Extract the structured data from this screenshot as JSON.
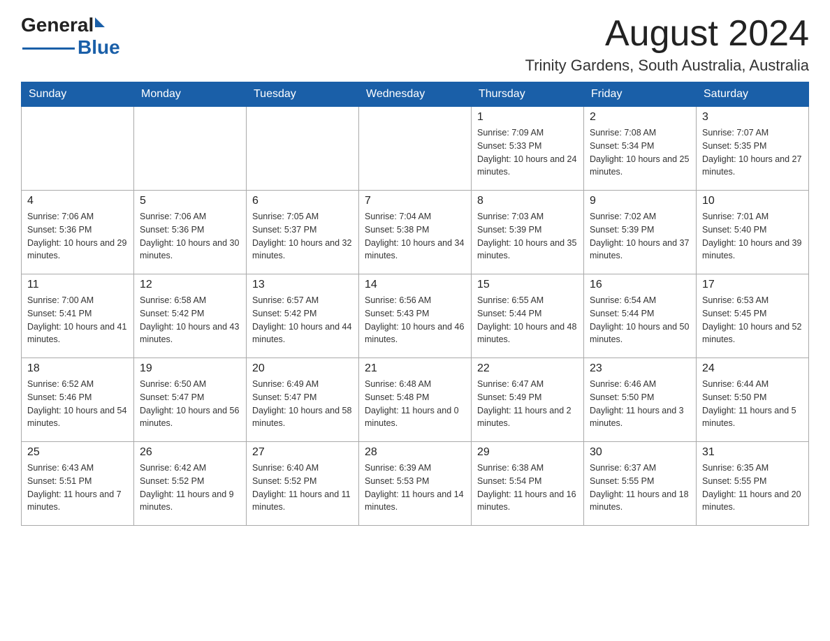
{
  "logo": {
    "general": "General",
    "blue": "Blue"
  },
  "title": {
    "month_year": "August 2024",
    "location": "Trinity Gardens, South Australia, Australia"
  },
  "weekdays": [
    "Sunday",
    "Monday",
    "Tuesday",
    "Wednesday",
    "Thursday",
    "Friday",
    "Saturday"
  ],
  "weeks": [
    [
      {
        "day": "",
        "info": ""
      },
      {
        "day": "",
        "info": ""
      },
      {
        "day": "",
        "info": ""
      },
      {
        "day": "",
        "info": ""
      },
      {
        "day": "1",
        "info": "Sunrise: 7:09 AM\nSunset: 5:33 PM\nDaylight: 10 hours and 24 minutes."
      },
      {
        "day": "2",
        "info": "Sunrise: 7:08 AM\nSunset: 5:34 PM\nDaylight: 10 hours and 25 minutes."
      },
      {
        "day": "3",
        "info": "Sunrise: 7:07 AM\nSunset: 5:35 PM\nDaylight: 10 hours and 27 minutes."
      }
    ],
    [
      {
        "day": "4",
        "info": "Sunrise: 7:06 AM\nSunset: 5:36 PM\nDaylight: 10 hours and 29 minutes."
      },
      {
        "day": "5",
        "info": "Sunrise: 7:06 AM\nSunset: 5:36 PM\nDaylight: 10 hours and 30 minutes."
      },
      {
        "day": "6",
        "info": "Sunrise: 7:05 AM\nSunset: 5:37 PM\nDaylight: 10 hours and 32 minutes."
      },
      {
        "day": "7",
        "info": "Sunrise: 7:04 AM\nSunset: 5:38 PM\nDaylight: 10 hours and 34 minutes."
      },
      {
        "day": "8",
        "info": "Sunrise: 7:03 AM\nSunset: 5:39 PM\nDaylight: 10 hours and 35 minutes."
      },
      {
        "day": "9",
        "info": "Sunrise: 7:02 AM\nSunset: 5:39 PM\nDaylight: 10 hours and 37 minutes."
      },
      {
        "day": "10",
        "info": "Sunrise: 7:01 AM\nSunset: 5:40 PM\nDaylight: 10 hours and 39 minutes."
      }
    ],
    [
      {
        "day": "11",
        "info": "Sunrise: 7:00 AM\nSunset: 5:41 PM\nDaylight: 10 hours and 41 minutes."
      },
      {
        "day": "12",
        "info": "Sunrise: 6:58 AM\nSunset: 5:42 PM\nDaylight: 10 hours and 43 minutes."
      },
      {
        "day": "13",
        "info": "Sunrise: 6:57 AM\nSunset: 5:42 PM\nDaylight: 10 hours and 44 minutes."
      },
      {
        "day": "14",
        "info": "Sunrise: 6:56 AM\nSunset: 5:43 PM\nDaylight: 10 hours and 46 minutes."
      },
      {
        "day": "15",
        "info": "Sunrise: 6:55 AM\nSunset: 5:44 PM\nDaylight: 10 hours and 48 minutes."
      },
      {
        "day": "16",
        "info": "Sunrise: 6:54 AM\nSunset: 5:44 PM\nDaylight: 10 hours and 50 minutes."
      },
      {
        "day": "17",
        "info": "Sunrise: 6:53 AM\nSunset: 5:45 PM\nDaylight: 10 hours and 52 minutes."
      }
    ],
    [
      {
        "day": "18",
        "info": "Sunrise: 6:52 AM\nSunset: 5:46 PM\nDaylight: 10 hours and 54 minutes."
      },
      {
        "day": "19",
        "info": "Sunrise: 6:50 AM\nSunset: 5:47 PM\nDaylight: 10 hours and 56 minutes."
      },
      {
        "day": "20",
        "info": "Sunrise: 6:49 AM\nSunset: 5:47 PM\nDaylight: 10 hours and 58 minutes."
      },
      {
        "day": "21",
        "info": "Sunrise: 6:48 AM\nSunset: 5:48 PM\nDaylight: 11 hours and 0 minutes."
      },
      {
        "day": "22",
        "info": "Sunrise: 6:47 AM\nSunset: 5:49 PM\nDaylight: 11 hours and 2 minutes."
      },
      {
        "day": "23",
        "info": "Sunrise: 6:46 AM\nSunset: 5:50 PM\nDaylight: 11 hours and 3 minutes."
      },
      {
        "day": "24",
        "info": "Sunrise: 6:44 AM\nSunset: 5:50 PM\nDaylight: 11 hours and 5 minutes."
      }
    ],
    [
      {
        "day": "25",
        "info": "Sunrise: 6:43 AM\nSunset: 5:51 PM\nDaylight: 11 hours and 7 minutes."
      },
      {
        "day": "26",
        "info": "Sunrise: 6:42 AM\nSunset: 5:52 PM\nDaylight: 11 hours and 9 minutes."
      },
      {
        "day": "27",
        "info": "Sunrise: 6:40 AM\nSunset: 5:52 PM\nDaylight: 11 hours and 11 minutes."
      },
      {
        "day": "28",
        "info": "Sunrise: 6:39 AM\nSunset: 5:53 PM\nDaylight: 11 hours and 14 minutes."
      },
      {
        "day": "29",
        "info": "Sunrise: 6:38 AM\nSunset: 5:54 PM\nDaylight: 11 hours and 16 minutes."
      },
      {
        "day": "30",
        "info": "Sunrise: 6:37 AM\nSunset: 5:55 PM\nDaylight: 11 hours and 18 minutes."
      },
      {
        "day": "31",
        "info": "Sunrise: 6:35 AM\nSunset: 5:55 PM\nDaylight: 11 hours and 20 minutes."
      }
    ]
  ]
}
